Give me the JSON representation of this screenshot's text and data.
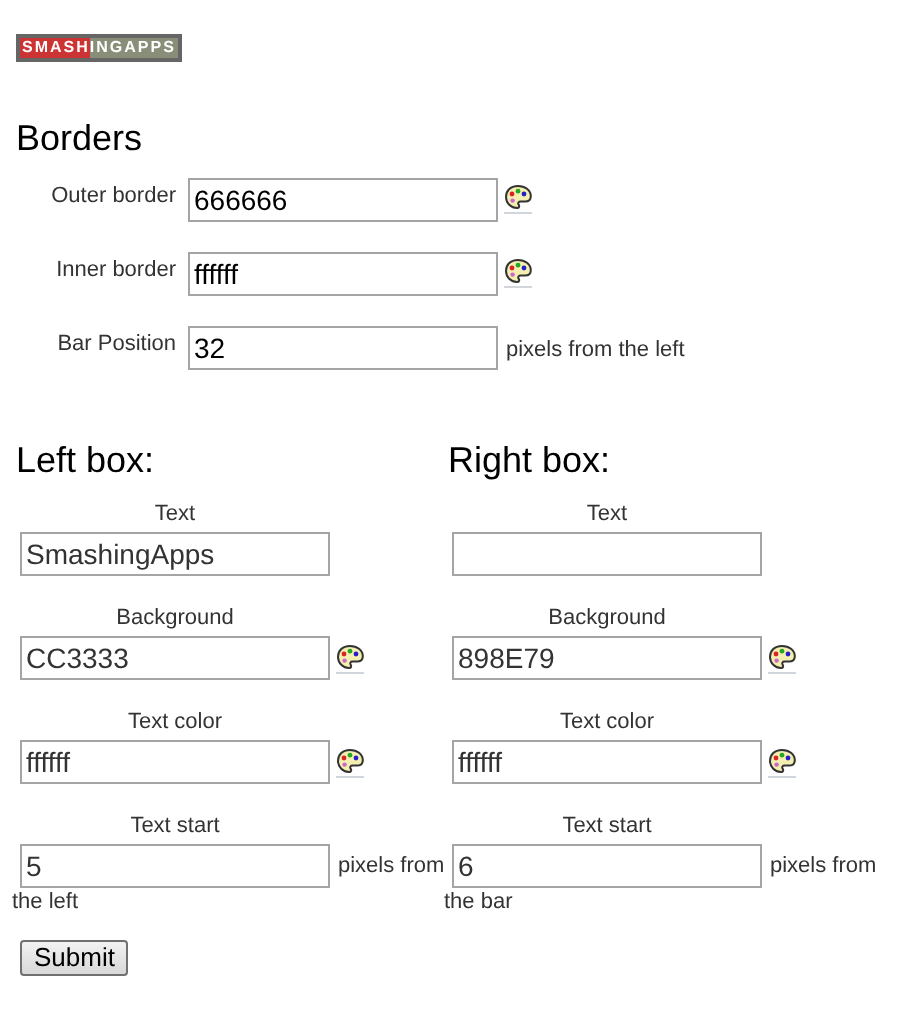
{
  "logo": "SMASHINGAPPS",
  "borders": {
    "title": "Borders",
    "fields": [
      {
        "label": "Outer border",
        "value": "666666",
        "kind": "color"
      },
      {
        "label": "Inner border",
        "value": "ffffff",
        "kind": "color"
      },
      {
        "label": "Bar Position",
        "value": "32",
        "kind": "number",
        "suffix": "pixels from the left"
      }
    ]
  },
  "boxes": [
    {
      "title": "Left box:",
      "fields": [
        {
          "label": "Text",
          "value": "SmashingApps",
          "kind": "text"
        },
        {
          "label": "Background",
          "value": "CC3333",
          "kind": "color"
        },
        {
          "label": "Text color",
          "value": "ffffff",
          "kind": "color"
        },
        {
          "label": "Text start",
          "value": "5",
          "kind": "number",
          "suffix": "pixels from",
          "suffix_2": "the left"
        }
      ]
    },
    {
      "title": "Right box:",
      "fields": [
        {
          "label": "Text",
          "kind": "text"
        },
        {
          "label": "Background",
          "value": "898E79",
          "kind": "color"
        },
        {
          "label": "Text color",
          "value": "ffffff",
          "kind": "color"
        },
        {
          "label": "Text start",
          "value": "6",
          "kind": "number",
          "suffix": "pixels from",
          "suffix_2": "the bar"
        }
      ]
    }
  ],
  "submit": "Submit"
}
